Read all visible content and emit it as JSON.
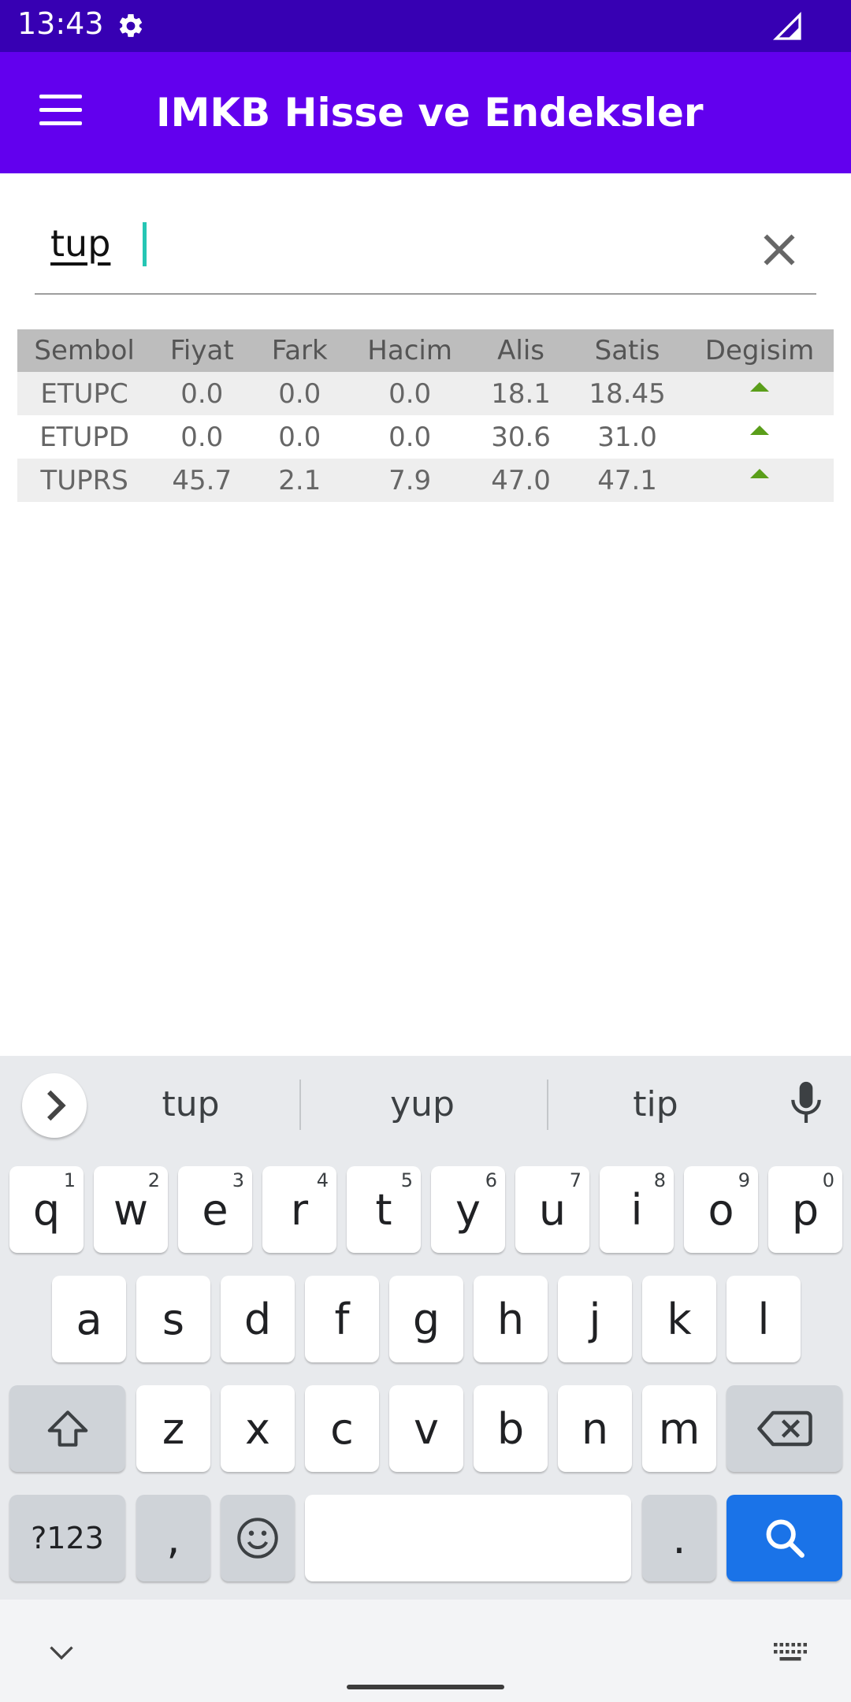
{
  "status_bar": {
    "time": "13:43"
  },
  "app_bar": {
    "title": "IMKB Hisse ve Endeksler"
  },
  "search": {
    "value": "tup"
  },
  "table": {
    "headers": [
      "Sembol",
      "Fiyat",
      "Fark",
      "Hacim",
      "Alis",
      "Satis",
      "Degisim"
    ],
    "rows": [
      {
        "sembol": "ETUPC",
        "fiyat": "0.0",
        "fark": "0.0",
        "hacim": "0.0",
        "alis": "18.1",
        "satis": "18.45",
        "degisim": "up"
      },
      {
        "sembol": "ETUPD",
        "fiyat": "0.0",
        "fark": "0.0",
        "hacim": "0.0",
        "alis": "30.6",
        "satis": "31.0",
        "degisim": "up"
      },
      {
        "sembol": "TUPRS",
        "fiyat": "45.7",
        "fark": "2.1",
        "hacim": "7.9",
        "alis": "47.0",
        "satis": "47.1",
        "degisim": "up"
      }
    ]
  },
  "keyboard": {
    "suggestions": [
      "tup",
      "yup",
      "tip"
    ],
    "row1": [
      {
        "key": "q",
        "hint": "1"
      },
      {
        "key": "w",
        "hint": "2"
      },
      {
        "key": "e",
        "hint": "3"
      },
      {
        "key": "r",
        "hint": "4"
      },
      {
        "key": "t",
        "hint": "5"
      },
      {
        "key": "y",
        "hint": "6"
      },
      {
        "key": "u",
        "hint": "7"
      },
      {
        "key": "i",
        "hint": "8"
      },
      {
        "key": "o",
        "hint": "9"
      },
      {
        "key": "p",
        "hint": "0"
      }
    ],
    "row2": [
      "a",
      "s",
      "d",
      "f",
      "g",
      "h",
      "j",
      "k",
      "l"
    ],
    "row3": [
      "z",
      "x",
      "c",
      "v",
      "b",
      "n",
      "m"
    ],
    "symbols_key": "?123",
    "comma_key": ",",
    "period_key": "."
  },
  "colors": {
    "status_bar": "#3700b3",
    "app_bar": "#6200ee",
    "cursor": "#26c6b4",
    "trend_up": "#5a9e1a",
    "search_key": "#1a73e8"
  },
  "icons": [
    "settings-gear-icon",
    "signal-icon",
    "hamburger-menu-icon",
    "close-icon",
    "trend-up-icon",
    "chevron-right-icon",
    "microphone-icon",
    "shift-icon",
    "backspace-icon",
    "emoji-icon",
    "search-icon",
    "chevron-down-icon",
    "keyboard-icon"
  ]
}
